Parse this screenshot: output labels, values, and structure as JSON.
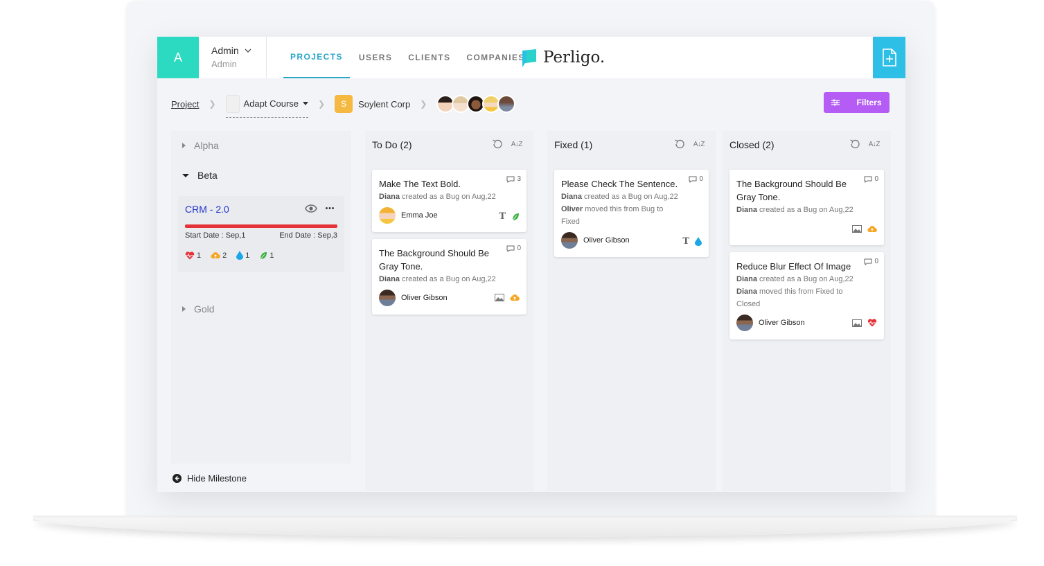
{
  "header": {
    "avatar_letter": "A",
    "user_name": "Admin",
    "user_role": "Admin",
    "nav": [
      "PROJECTS",
      "USERS",
      "CLIENTS",
      "COMPANIES"
    ],
    "active_nav": "PROJECTS",
    "brand": "Perligo."
  },
  "breadcrumb": {
    "project": "Project",
    "course": "Adapt Course",
    "client_letter": "S",
    "client": "Soylent Corp"
  },
  "filters_label": "Filters",
  "milestones": {
    "groups": [
      "Alpha",
      "Beta",
      "Gold"
    ],
    "card": {
      "title": "CRM - 2.0",
      "start": "Start Date : Sep,1",
      "end": "End Date : Sep,3",
      "stats": [
        "1",
        "2",
        "1",
        "1"
      ]
    },
    "hide_label": "Hide Milestone"
  },
  "columns": [
    {
      "title": "To Do (2)",
      "sort": "A↓Z",
      "cards": [
        {
          "title": "Make The Text Bold.",
          "comments": "3",
          "lines": [
            {
              "who": "Diana",
              "text": " created as a Bug on Aug,22"
            }
          ],
          "assignee": "Emma Joe"
        },
        {
          "title": "The Background Should Be Gray Tone.",
          "comments": "0",
          "lines": [
            {
              "who": "Diana",
              "text": " created as a Bug on Aug,22"
            }
          ],
          "assignee": "Oliver Gibson"
        }
      ]
    },
    {
      "title": "Fixed (1)",
      "sort": "A↓Z",
      "cards": [
        {
          "title": "Please Check The Sentence.",
          "comments": "0",
          "lines": [
            {
              "who": "Diana",
              "text": " created as a Bug on Aug,22"
            },
            {
              "who": "Oliver",
              "text": " moved this from  Bug to"
            },
            {
              "who": "",
              "text": " Fixed"
            }
          ],
          "assignee": "Oliver Gibson"
        }
      ]
    },
    {
      "title": "Closed (2)",
      "sort": "A↓Z",
      "cards": [
        {
          "title": "The Background Should Be Gray Tone.",
          "comments": "0",
          "lines": [
            {
              "who": "Diana",
              "text": " created as a Bug on Aug,22"
            }
          ],
          "assignee": ""
        },
        {
          "title": "Reduce Blur Effect Of Image",
          "comments": "0",
          "lines": [
            {
              "who": "Diana",
              "text": " created as a Bug on Aug,22"
            },
            {
              "who": "Diana",
              "text": " moved this from  Fixed to"
            },
            {
              "who": "",
              "text": " Closed"
            }
          ],
          "assignee": "Oliver Gibson"
        }
      ]
    }
  ],
  "colors": {
    "teal": "#2cd9c1",
    "blue": "#2ebfe6",
    "purple": "#b45cf3",
    "red": "#e53238",
    "orange": "#f5a623"
  }
}
